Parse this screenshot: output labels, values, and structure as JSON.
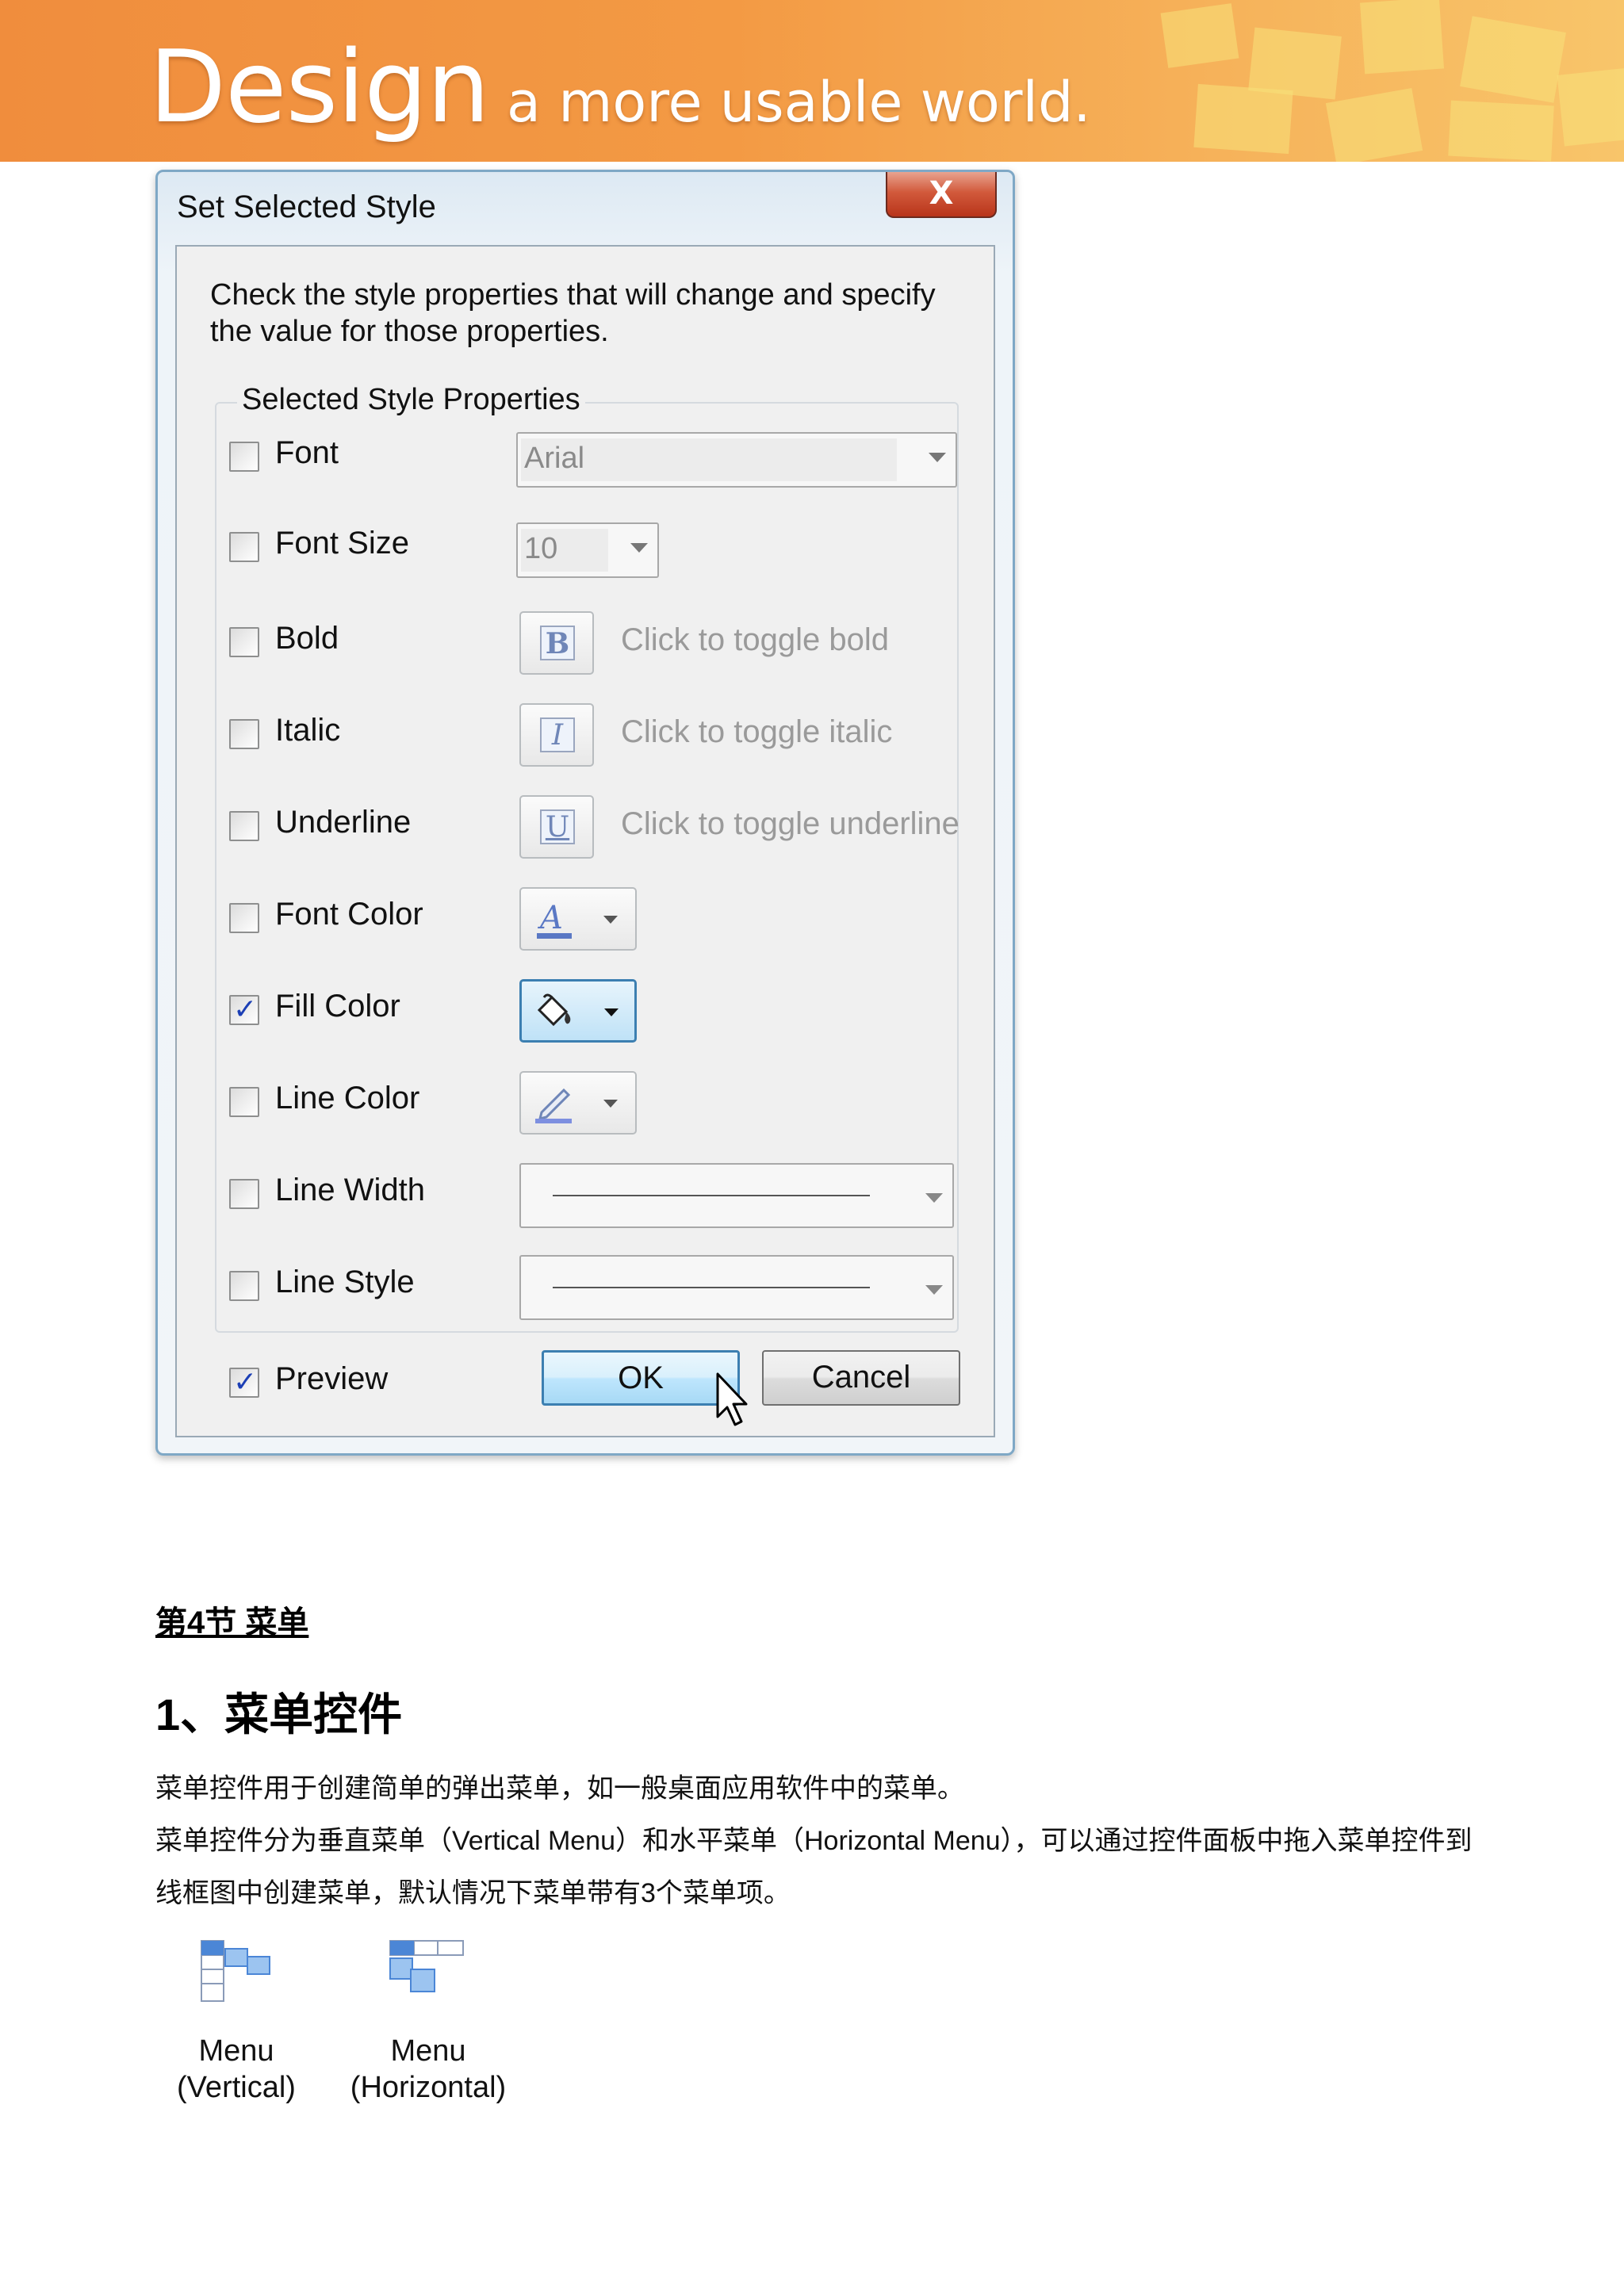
{
  "banner": {
    "big": "Design",
    "small": "a more usable world."
  },
  "dialog": {
    "title": "Set Selected Style",
    "close_label": "X",
    "description": "Check the style properties that will change and specify the value for those properties.",
    "group_label": "Selected Style Properties",
    "rows": {
      "font": {
        "label": "Font",
        "checked": false,
        "value": "Arial"
      },
      "font_size": {
        "label": "Font Size",
        "checked": false,
        "value": "10"
      },
      "bold": {
        "label": "Bold",
        "checked": false,
        "glyph": "B",
        "hint": "Click to toggle bold"
      },
      "italic": {
        "label": "Italic",
        "checked": false,
        "glyph": "I",
        "hint": "Click to toggle italic"
      },
      "underline": {
        "label": "Underline",
        "checked": false,
        "glyph": "U",
        "hint": "Click to toggle underline"
      },
      "font_color": {
        "label": "Font Color",
        "checked": false,
        "icon": "font-color-icon"
      },
      "fill_color": {
        "label": "Fill Color",
        "checked": true,
        "icon": "paint-bucket-icon"
      },
      "line_color": {
        "label": "Line Color",
        "checked": false,
        "icon": "pencil-icon"
      },
      "line_width": {
        "label": "Line Width",
        "checked": false
      },
      "line_style": {
        "label": "Line Style",
        "checked": false
      }
    },
    "preview": {
      "label": "Preview",
      "checked": true
    },
    "ok_label": "OK",
    "cancel_label": "Cancel"
  },
  "document": {
    "section": "第4节 菜单",
    "heading": "1、菜单控件",
    "paragraphs": [
      "菜单控件用于创建简单的弹出菜单，如一般桌面应用软件中的菜单。",
      "菜单控件分为垂直菜单（Vertical Menu）和水平菜单（Horizontal Menu），可以通过控件面板中拖入菜单控件到",
      "线框图中创建菜单，默认情况下菜单带有3个菜单项。"
    ],
    "widgets": [
      {
        "line1": "Menu",
        "line2": "(Vertical)",
        "icon": "vertical-menu-icon"
      },
      {
        "line1": "Menu",
        "line2": "(Horizontal)",
        "icon": "horizontal-menu-icon"
      }
    ]
  }
}
